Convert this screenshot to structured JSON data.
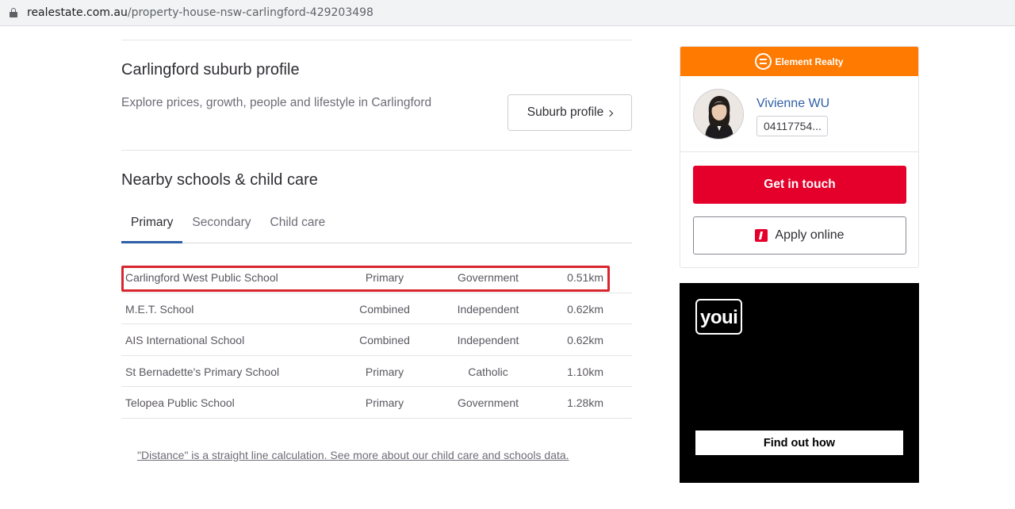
{
  "browser": {
    "url_domain": "realestate.com.au",
    "url_path": "/property-house-nsw-carlingford-429203498"
  },
  "suburb": {
    "title": "Carlingford suburb profile",
    "subtitle": "Explore prices, growth, people and lifestyle in Carlingford",
    "button_label": "Suburb profile"
  },
  "schools": {
    "title": "Nearby schools & child care",
    "tabs": [
      {
        "label": "Primary"
      },
      {
        "label": "Secondary"
      },
      {
        "label": "Child care"
      }
    ],
    "active_tab": "Primary",
    "rows": [
      {
        "name": "Carlingford West Public School",
        "type": "Primary",
        "sector": "Government",
        "distance": "0.51km"
      },
      {
        "name": "M.E.T. School",
        "type": "Combined",
        "sector": "Independent",
        "distance": "0.62km"
      },
      {
        "name": "AIS International School",
        "type": "Combined",
        "sector": "Independent",
        "distance": "0.62km"
      },
      {
        "name": "St Bernadette's Primary School",
        "type": "Primary",
        "sector": "Catholic",
        "distance": "1.10km"
      },
      {
        "name": "Telopea Public School",
        "type": "Primary",
        "sector": "Government",
        "distance": "1.28km"
      }
    ],
    "footnote": "\"Distance\" is a straight line calculation. See more about our child care and schools data."
  },
  "agent": {
    "agency": "Element Realty",
    "name": "Vivienne WU",
    "phone": "04117754...",
    "get_in_touch": "Get in touch",
    "apply_online": "Apply online",
    "brand_color": "#ff7a00",
    "cta_color": "#e4002b"
  },
  "ad": {
    "brand": "youi",
    "button_label": "Find out how"
  }
}
